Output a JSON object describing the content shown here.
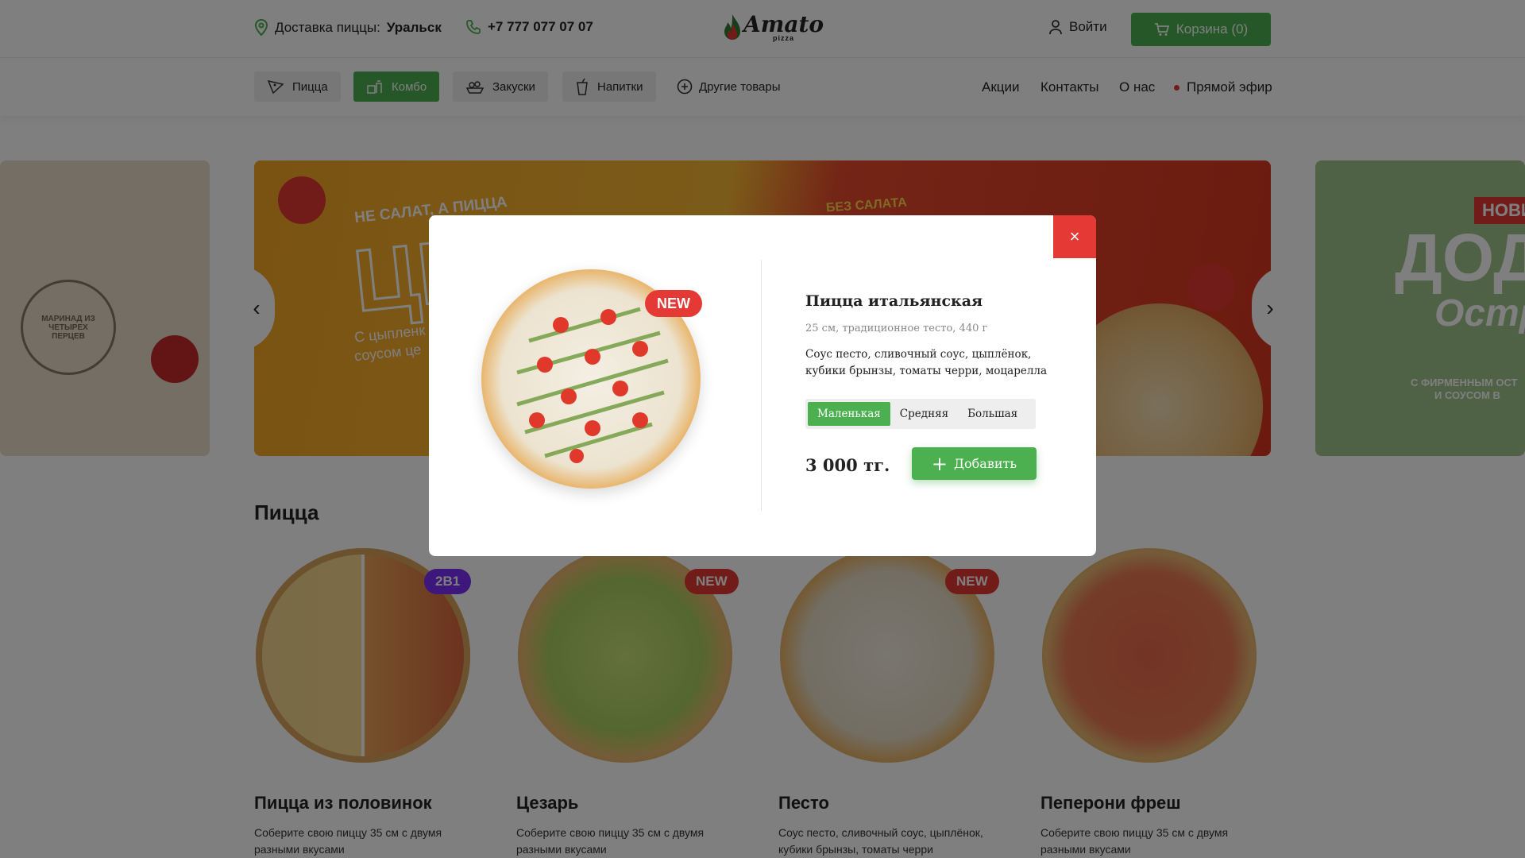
{
  "header": {
    "delivery_label": "Доставка пиццы:",
    "city": "Уральск",
    "phone": "+7 777 077 07 07",
    "logo_text": "Amato",
    "logo_sub": "pizza",
    "login": "Войти",
    "cart": "Корзина (0)"
  },
  "nav": {
    "categories": [
      {
        "label": "Пицца",
        "icon": "pizza-slice-icon"
      },
      {
        "label": "Комбо",
        "icon": "combo-icon"
      },
      {
        "label": "Закуски",
        "icon": "snacks-icon"
      },
      {
        "label": "Напитки",
        "icon": "drink-icon"
      }
    ],
    "other": "Другие товары",
    "links": [
      "Акции",
      "Контакты",
      "О нас",
      "Прямой эфир"
    ]
  },
  "banner": {
    "main_texts": [
      "НЕ САЛАТ, А ПИЦЦА",
      "ЦЕ",
      "С цыпленк",
      "соусом це",
      "БЕЗ САЛАТА"
    ],
    "left_text": "МАРИНАД ИЗ ЧЕТЫРЕХ ПЕРЦЕВ",
    "right_texts": [
      "НОВИН",
      "ДОДО",
      "Остр",
      "С ФИРМЕННЫМ ОСТ",
      "И СОУСОМ В"
    ]
  },
  "section": {
    "title": "Пицца",
    "products": [
      {
        "name": "Пицца из половинок",
        "desc": "Соберите свою пиццу 35 см с двумя разными вкусами",
        "badge": "2В1"
      },
      {
        "name": "Цезарь",
        "desc": "Соберите свою пиццу 35 см с двумя разными вкусами",
        "badge": "NEW"
      },
      {
        "name": "Песто",
        "desc": "Соус песто, сливочный соус, цыплёнок, кубики брынзы, томаты черри",
        "badge": "NEW"
      },
      {
        "name": "Пеперони фреш",
        "desc": "Соберите свою пиццу 35 см с двумя разными вкусами",
        "badge": ""
      }
    ]
  },
  "modal": {
    "badge": "NEW",
    "title": "Пицца итальянская",
    "subtitle": "25 см, традиционное тесто, 440 г",
    "description": "Соус песто, сливочный соус, цыплёнок, кубики брынзы, томаты черри, моцарелла",
    "sizes": [
      "Маленькая",
      "Средняя",
      "Большая"
    ],
    "selected_size": "Маленькая",
    "price": "3 000 тг.",
    "add": "Добавить",
    "close": "×"
  },
  "colors": {
    "accent": "#4caf50",
    "danger": "#e53935",
    "purple_badge": "#7b2ff7"
  }
}
